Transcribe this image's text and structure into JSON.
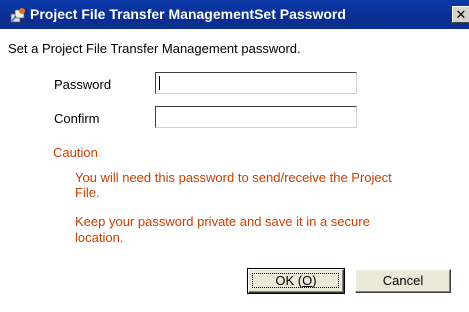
{
  "window": {
    "title": "Project File Transfer ManagementSet Password",
    "close_symbol": "✕"
  },
  "instructions": "Set a Project File Transfer Management password.",
  "fields": {
    "password_label": "Password",
    "password_value": "",
    "confirm_label": "Confirm",
    "confirm_value": ""
  },
  "caution": {
    "heading": "Caution",
    "line1a": "You will need this password to send/receive the Project",
    "line1b": "File.",
    "line2a": "Keep your password private and save it in a secure",
    "line2b": "location."
  },
  "buttons": {
    "ok_label": "OK (",
    "ok_mnemonic": "O",
    "ok_close": ")",
    "cancel_label": "Cancel"
  },
  "colors": {
    "titlebar": "#0a2f96",
    "caution_text": "#cc3d00"
  },
  "icons": {
    "title": "project-transfer-icon",
    "close": "close-icon"
  }
}
